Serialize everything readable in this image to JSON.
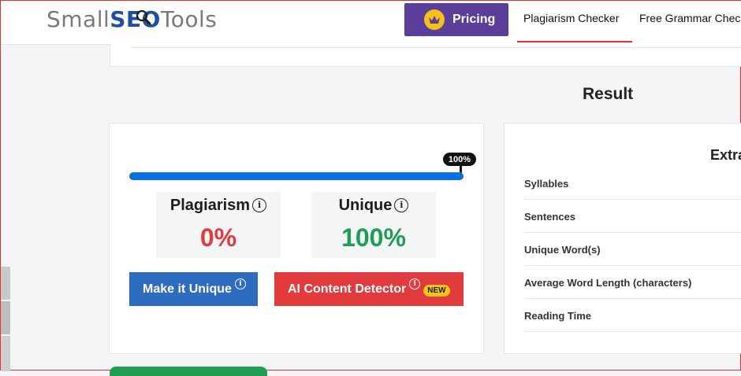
{
  "header": {
    "logo_prefix": "Small",
    "logo_seo": "SEO",
    "logo_suffix": "Tools",
    "pricing_label": "Pricing",
    "nav": [
      "Plagiarism Checker",
      "Free Grammar Checker"
    ]
  },
  "result": {
    "title": "Result",
    "progress_label": "100%",
    "progress_fraction": 1.0,
    "plagiarism_label": "Plagiarism",
    "plagiarism_value": "0%",
    "unique_label": "Unique",
    "unique_value": "100%",
    "make_unique_label": "Make it Unique",
    "ai_detector_label": "AI Content Detector",
    "new_badge": "NEW",
    "info_glyph": "i"
  },
  "details": {
    "title": "Extra",
    "rows": [
      "Syllables",
      "Sentences",
      "Unique Word(s)",
      "Average Word Length (characters)",
      "Reading Time"
    ]
  },
  "colors": {
    "accent_blue": "#0a6fe3",
    "pricing_purple": "#5b3e9a",
    "plagiarism_red": "#e23b3e",
    "unique_green": "#1f9d55",
    "button_blue": "#2e6cc0",
    "badge_yellow": "#f7c516"
  },
  "icons": [
    "magnifier-icon",
    "crown-icon",
    "info-icon"
  ]
}
